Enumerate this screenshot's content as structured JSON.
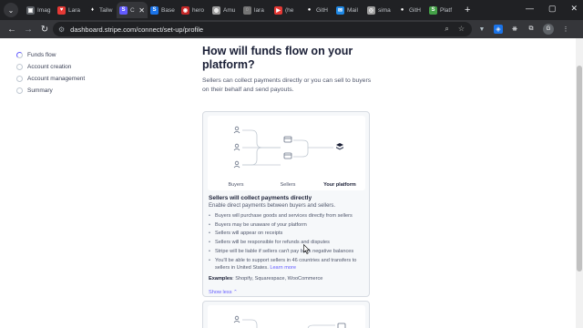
{
  "browser": {
    "tabs": [
      {
        "title": "Imag",
        "color": "#5f6368",
        "glyph": "▣"
      },
      {
        "title": "Lara",
        "color": "#e53935",
        "glyph": "♥"
      },
      {
        "title": "Tailw",
        "color": "#202124",
        "glyph": "♦"
      },
      {
        "title": "C",
        "color": "#635bff",
        "glyph": "S",
        "active": true
      },
      {
        "title": "Base",
        "color": "#1a73e8",
        "glyph": "S"
      },
      {
        "title": "hero",
        "color": "#c62828",
        "glyph": "◉"
      },
      {
        "title": "Amu",
        "color": "#9e9e9e",
        "glyph": "◍"
      },
      {
        "title": "lara",
        "color": "#757575",
        "glyph": "◌"
      },
      {
        "title": "(he",
        "color": "#e53935",
        "glyph": "▶"
      },
      {
        "title": "GitH",
        "color": "#202124",
        "glyph": "●"
      },
      {
        "title": "Mail",
        "color": "#1e88e5",
        "glyph": "✉"
      },
      {
        "title": "sima",
        "color": "#9e9e9e",
        "glyph": "◎"
      },
      {
        "title": "GitH",
        "color": "#202124",
        "glyph": "●"
      },
      {
        "title": "Platf",
        "color": "#43a047",
        "glyph": "S"
      }
    ],
    "url": "dashboard.stripe.com/connect/set-up/profile"
  },
  "steps": [
    {
      "label": "Funds flow",
      "active": true
    },
    {
      "label": "Account creation",
      "active": false
    },
    {
      "label": "Account management",
      "active": false
    },
    {
      "label": "Summary",
      "active": false
    }
  ],
  "main": {
    "heading": "How will funds flow on your platform?",
    "subtext": "Sellers can collect payments directly or you can sell to buyers on their behalf and send payouts."
  },
  "card": {
    "diagram_labels": {
      "buyers": "Buyers",
      "sellers": "Sellers",
      "platform": "Your platform"
    },
    "title": "Sellers will collect payments directly",
    "description": "Enable direct payments between buyers and sellers.",
    "bullets": [
      "Buyers will purchase goods and services directly from sellers",
      "Buyers may be unaware of your platform",
      "Sellers will appear on receipts",
      "Sellers will be responsible for refunds and disputes",
      "Stripe will be liable if sellers can't pay back negative balances"
    ],
    "last_bullet": "You'll be able to support sellers in 46 countries and transfers to sellers in United States.",
    "learn_more": "Learn more",
    "examples_label": "Examples",
    "examples_text": ": Shopify, Squarespace, WooCommerce",
    "show_less": "Show less"
  },
  "colors": {
    "accent": "#635bff",
    "chrome_dark": "#202124",
    "chrome_toolbar": "#35363a"
  }
}
